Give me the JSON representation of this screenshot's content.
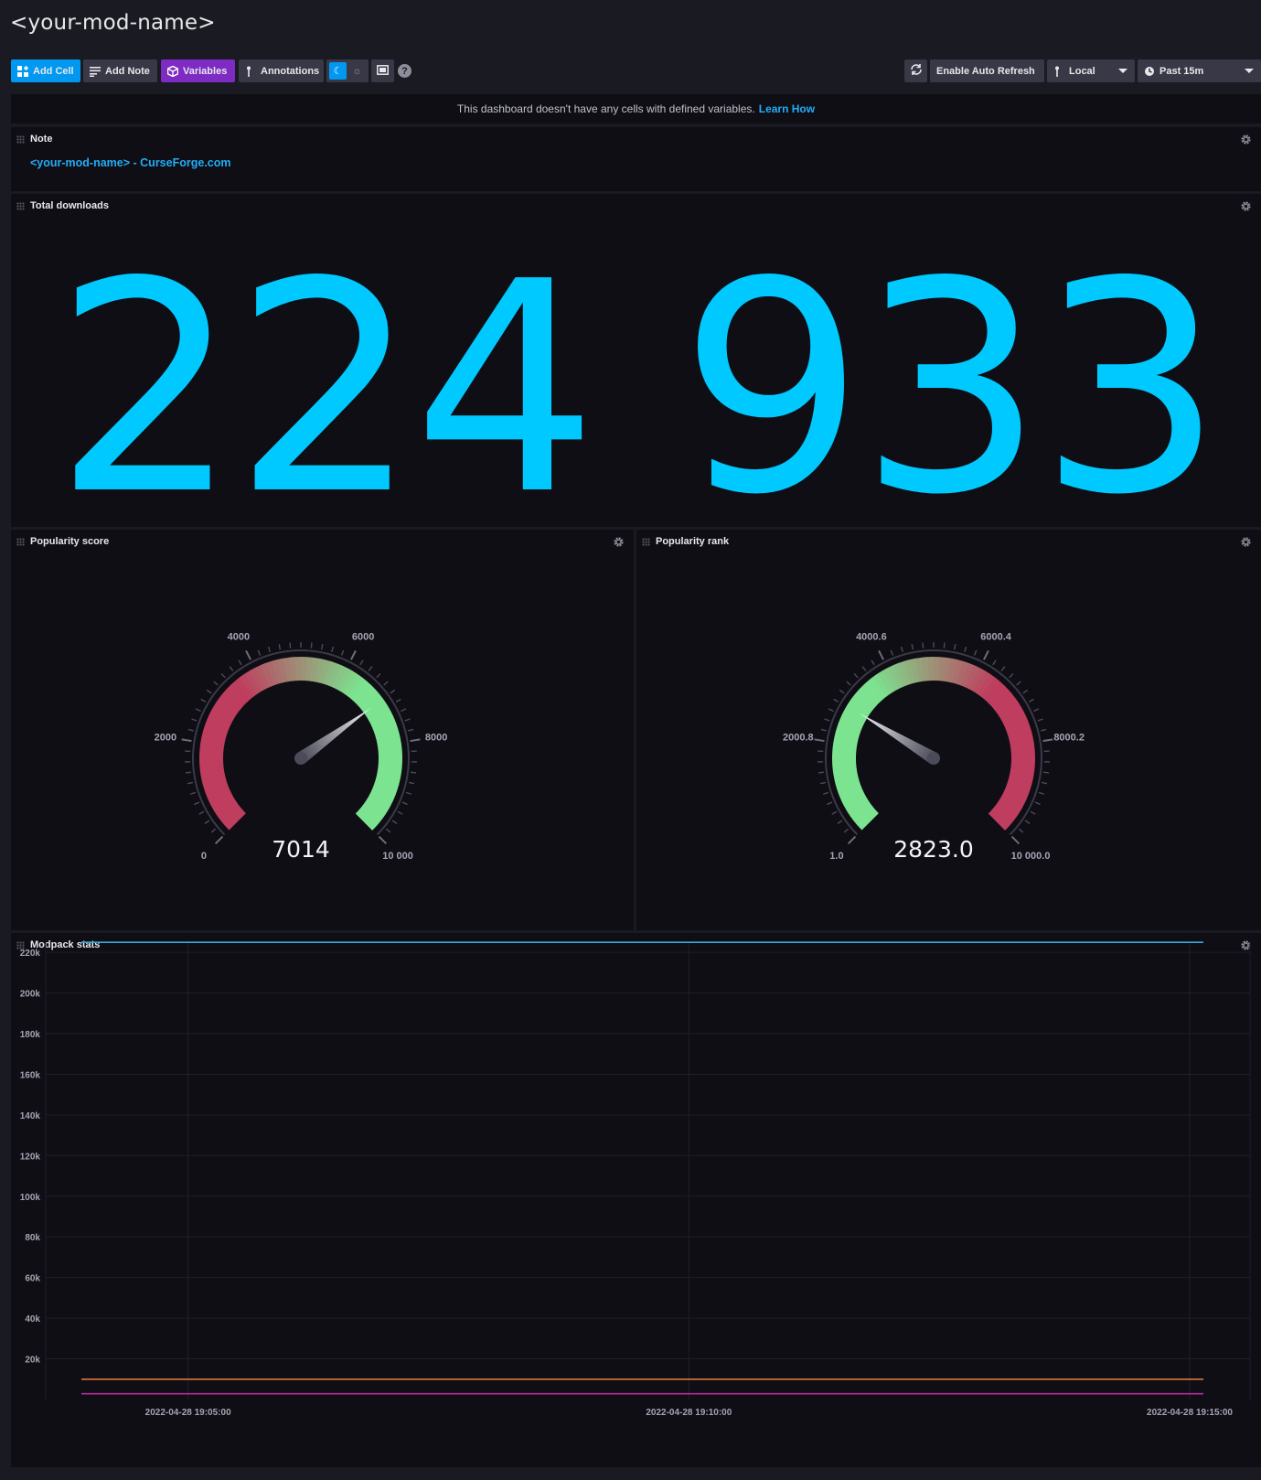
{
  "dashboard": {
    "title": "<your-mod-name>"
  },
  "toolbar": {
    "add_cell": "Add Cell",
    "add_note": "Add Note",
    "variables": "Variables",
    "annotations": "Annotations",
    "enable_auto_refresh": "Enable Auto Refresh",
    "timezone": "Local",
    "time_range": "Past 15m",
    "help": "?"
  },
  "banner": {
    "text": "This dashboard doesn't have any cells with defined variables.",
    "link": "Learn How"
  },
  "cells": {
    "note": {
      "title": "Note",
      "link_text": "<your-mod-name> - CurseForge.com"
    },
    "total_downloads": {
      "title": "Total downloads",
      "value": "224 933",
      "color": "#00c9ff"
    },
    "popularity_score": {
      "title": "Popularity score",
      "value": 7014,
      "display_value": "7014",
      "min": 0,
      "max": 10000,
      "tick_labels": [
        "0",
        "2000",
        "4000",
        "6000",
        "8000",
        "10 000"
      ],
      "low_color": "#bf3d5e",
      "high_color": "#7ce490"
    },
    "popularity_rank": {
      "title": "Popularity rank",
      "value": 2823.0,
      "display_value": "2823.0",
      "min": 1.0,
      "max": 10000.0,
      "tick_labels": [
        "1.0",
        "2000.8",
        "4000.6",
        "6000.4",
        "8000.2",
        "10 000.0"
      ],
      "low_color": "#7ce490",
      "high_color": "#bf3d5e"
    },
    "modpack_stats": {
      "title": "Modpack stats"
    }
  },
  "chart_data": {
    "type": "line",
    "title": "Modpack stats",
    "y_tick_labels": [
      "220k",
      "200k",
      "180k",
      "160k",
      "140k",
      "120k",
      "100k",
      "80k",
      "60k",
      "40k",
      "20k"
    ],
    "x_tick_labels": [
      "2022-04-28 19:05:00",
      "2022-04-28 19:10:00",
      "2022-04-28 19:15:00"
    ],
    "x_range": [
      "2022-04-28 19:03:55",
      "2022-04-28 19:15:00"
    ],
    "ylim": [
      0,
      225000
    ],
    "grid": true,
    "series": [
      {
        "color": "#3aa9d8",
        "values": [
          224933,
          224933
        ]
      },
      {
        "color": "#d9773b",
        "values": [
          10000,
          10000
        ]
      },
      {
        "color": "#b82b9a",
        "values": [
          2823,
          2823
        ]
      }
    ]
  }
}
